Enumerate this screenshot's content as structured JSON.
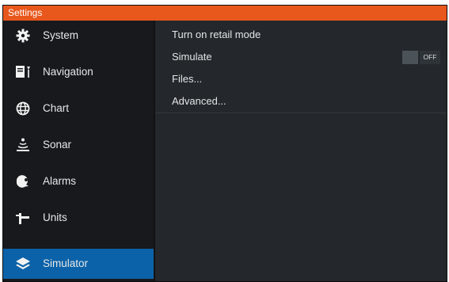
{
  "window": {
    "title": "Settings"
  },
  "sidebar": {
    "items": [
      {
        "label": "System",
        "icon": "gear-icon"
      },
      {
        "label": "Navigation",
        "icon": "navigation-icon"
      },
      {
        "label": "Chart",
        "icon": "globe-icon"
      },
      {
        "label": "Sonar",
        "icon": "sonar-icon"
      },
      {
        "label": "Alarms",
        "icon": "alarm-icon"
      },
      {
        "label": "Units",
        "icon": "units-icon"
      },
      {
        "label": "Simulator",
        "icon": "layers-icon",
        "selected": true
      }
    ]
  },
  "main": {
    "rows": [
      {
        "label": "Turn on retail mode"
      },
      {
        "label": "Simulate",
        "toggle": "OFF"
      },
      {
        "label": "Files..."
      },
      {
        "label": "Advanced..."
      }
    ]
  },
  "colors": {
    "title_bar": "#e8571c",
    "selected_item": "#0b62a8",
    "sidebar_bg": "#17191c",
    "content_bg": "#24282c"
  }
}
